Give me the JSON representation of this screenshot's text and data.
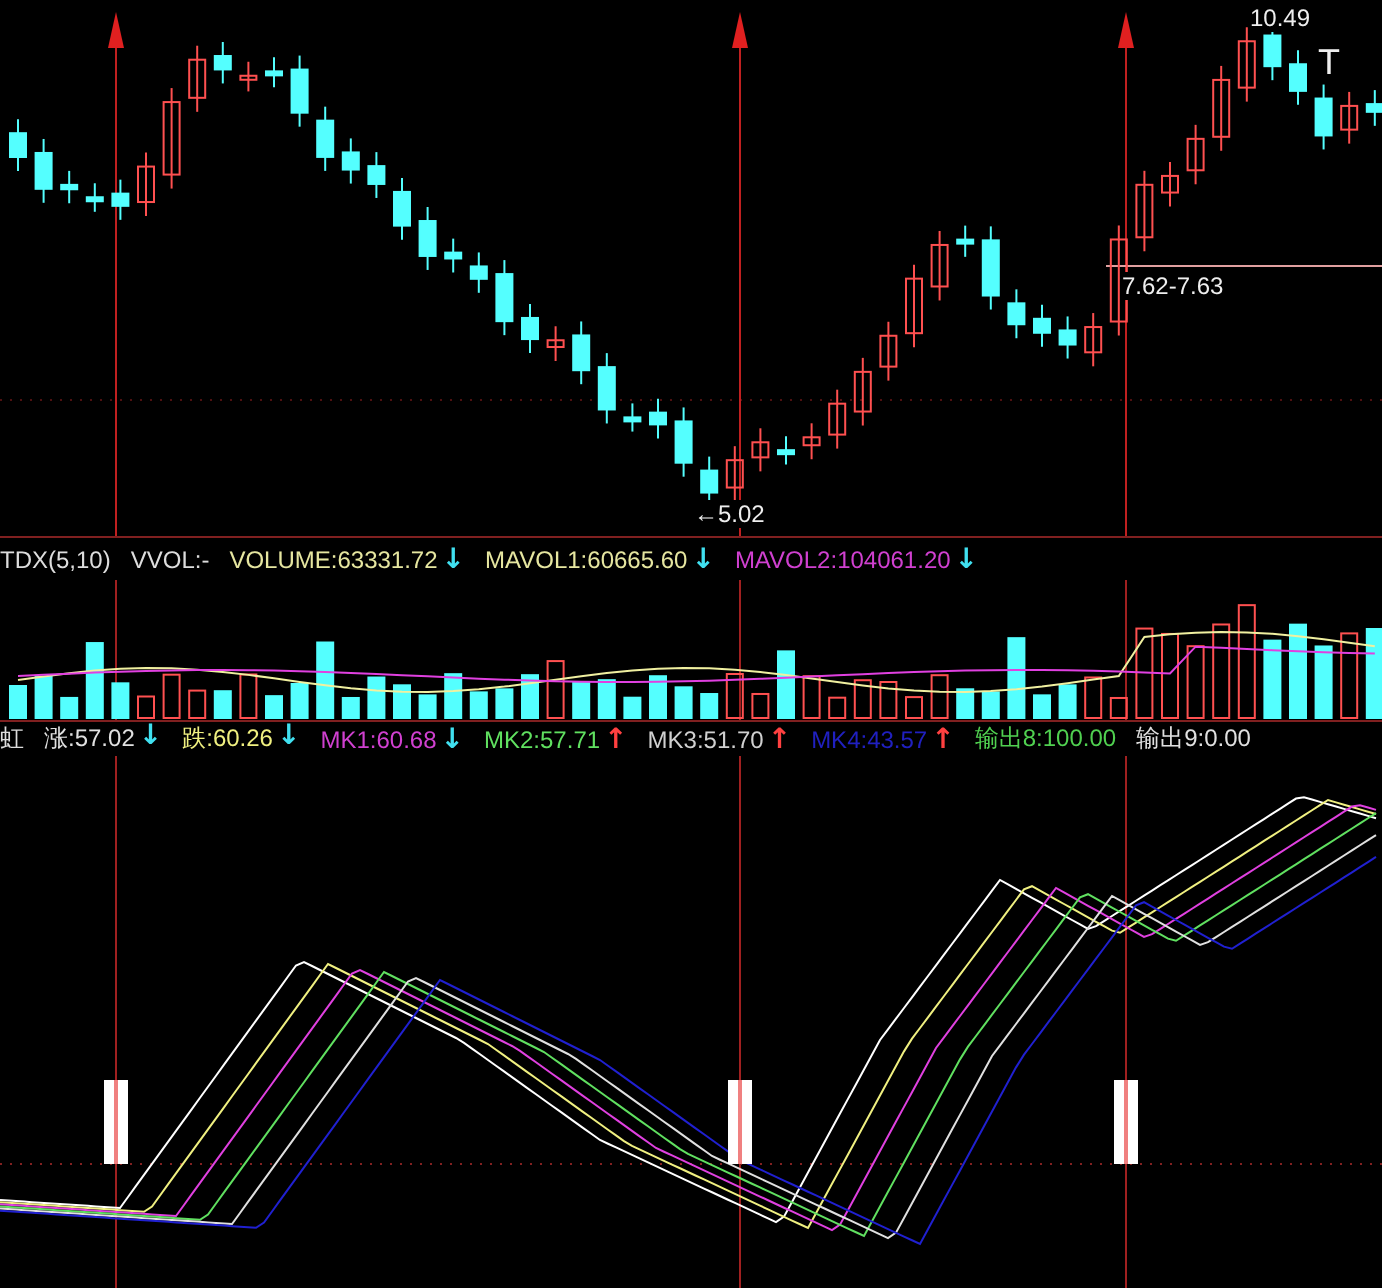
{
  "price_chart": {
    "labels": [
      {
        "text": "10.49",
        "kind": "high"
      },
      {
        "text": "←5.02",
        "kind": "low"
      },
      {
        "text": "T",
        "kind": "mark"
      },
      {
        "text": "7.62-7.63",
        "kind": "range"
      }
    ]
  },
  "volume_panel": {
    "title": "TDX(5,10)",
    "formula": "VVOL:-",
    "readings": [
      {
        "text": "VOLUME:63331.72",
        "color": "#e6e6a0",
        "arrow": {
          "text": "↓",
          "color": "#40e0f0"
        }
      },
      {
        "text": "MAVOL1:60665.60",
        "color": "#e6e6a0",
        "arrow": {
          "text": "↓",
          "color": "#40e0f0"
        }
      },
      {
        "text": "MAVOL2:104061.20",
        "color": "#d040d0",
        "arrow": {
          "text": "↓",
          "color": "#40e0f0"
        }
      }
    ]
  },
  "indicator_panel": {
    "title": "虹",
    "readings": [
      {
        "text": "涨:57.02",
        "color": "#e0e0e0",
        "arrow": {
          "text": "↓",
          "color": "#40e0f0"
        }
      },
      {
        "text": "跌:60.26",
        "color": "#f0f080",
        "arrow": {
          "text": "↓",
          "color": "#40e0f0"
        }
      },
      {
        "text": "MK1:60.68",
        "color": "#d040d0",
        "arrow": {
          "text": "↓",
          "color": "#40e0f0"
        }
      },
      {
        "text": "MK2:57.71",
        "color": "#60e060",
        "arrow": {
          "text": "↑",
          "color": "#ff4040"
        }
      },
      {
        "text": "MK3:51.70",
        "color": "#d0d0d0",
        "arrow": {
          "text": "↑",
          "color": "#ff4040"
        }
      },
      {
        "text": "MK4:43.57",
        "color": "#2020c0",
        "arrow": {
          "text": "↑",
          "color": "#ff4040"
        }
      },
      {
        "text": "输出8:100.00",
        "color": "#50d050"
      },
      {
        "text": "输出9:0.00",
        "color": "#e0e0e0"
      }
    ]
  }
}
